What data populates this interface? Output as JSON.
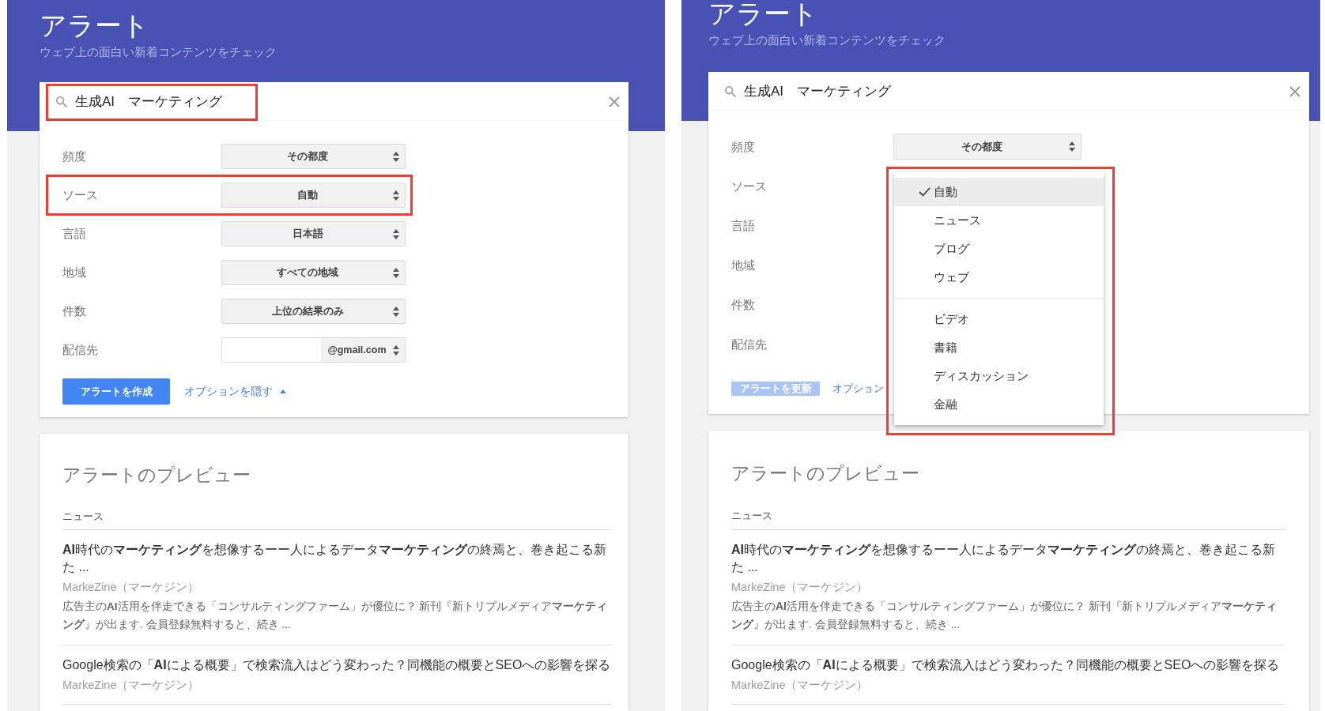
{
  "panels": [
    {
      "header": {
        "title": "アラート",
        "subtitle": "ウェブ上の面白い新着コンテンツをチェック"
      },
      "search": {
        "value": "生成AI　マーケティング",
        "highlighted": true
      },
      "options": [
        {
          "label": "頻度",
          "value": "その都度",
          "highlighted": false,
          "redacted": false
        },
        {
          "label": "ソース",
          "value": "自動",
          "highlighted": true,
          "redacted": false
        },
        {
          "label": "言語",
          "value": "日本語",
          "highlighted": false,
          "redacted": false
        },
        {
          "label": "地域",
          "value": "すべての地域",
          "highlighted": false,
          "redacted": false
        },
        {
          "label": "件数",
          "value": "上位の結果のみ",
          "highlighted": false,
          "redacted": false
        },
        {
          "label": "配信先",
          "value": "@gmail.com",
          "highlighted": false,
          "redacted": true
        }
      ],
      "submit_button": {
        "label": "アラートを作成",
        "disabled": false
      },
      "options_link": {
        "label": "オプションを隠す",
        "expanded": true
      },
      "preview": {
        "title": "アラートのプレビュー",
        "section": "ニュース",
        "articles": [
          {
            "title": "**AI**時代の**マーケティング**を想像するーー人によるデータ**マーケティング**の終焉と、巻き起こる新た ...",
            "source": "MarkeZine（マーケジン）",
            "snippet": "広告主の**AI**活用を伴走できる「コンサルティングファーム」が優位に？ 新刊『新トリプルメディア**マーケティング**』が出ます. 会員登録無料すると、続き ..."
          },
          {
            "title": "Google検索の「**AI**による概要」で検索流入はどう変わった？同機能の概要とSEOへの影響を探る",
            "source": "MarkeZine（マーケジン）"
          }
        ]
      }
    },
    {
      "header": {
        "title": "アラート",
        "subtitle": "ウェブ上の面白い新着コンテンツをチェック"
      },
      "search": {
        "value": "生成AI　マーケティング"
      },
      "options": [
        {
          "label": "頻度",
          "value": "その都度"
        },
        {
          "label": "ソース"
        },
        {
          "label": "言語"
        },
        {
          "label": "地域"
        },
        {
          "label": "件数"
        },
        {
          "label": "配信先"
        }
      ],
      "submit_button": {
        "label": "アラートを更新",
        "disabled": true
      },
      "options_link": {
        "label": "オプション"
      },
      "dropdown": {
        "highlighted": true,
        "sections": [
          {
            "options": [
              {
                "label": "自動",
                "selected": true
              },
              {
                "label": "ニュース",
                "selected": false
              },
              {
                "label": "ブログ",
                "selected": false
              },
              {
                "label": "ウェブ",
                "selected": false
              }
            ]
          },
          {
            "options": [
              {
                "label": "ビデオ",
                "selected": false
              },
              {
                "label": "書籍",
                "selected": false
              },
              {
                "label": "ディスカッション",
                "selected": false
              },
              {
                "label": "金融",
                "selected": false
              }
            ]
          }
        ]
      },
      "preview": {
        "title": "アラートのプレビュー",
        "section": "ニュース",
        "articles": [
          {
            "title": "**AI**時代の**マーケティング**を想像するーー人によるデータ**マーケティング**の終焉と、巻き起こる新た ...",
            "source": "MarkeZine（マーケジン）",
            "snippet": "広告主の**AI**活用を伴走できる「コンサルティングファーム」が優位に？ 新刊『新トリプルメディア**マーケティング**』が出ます. 会員登録無料すると、続き ..."
          },
          {
            "title": "Google検索の「**AI**による概要」で検索流入はどう変わった？同機能の概要とSEOへの影響を探る",
            "source": "MarkeZine（マーケジン）"
          }
        ]
      }
    }
  ]
}
